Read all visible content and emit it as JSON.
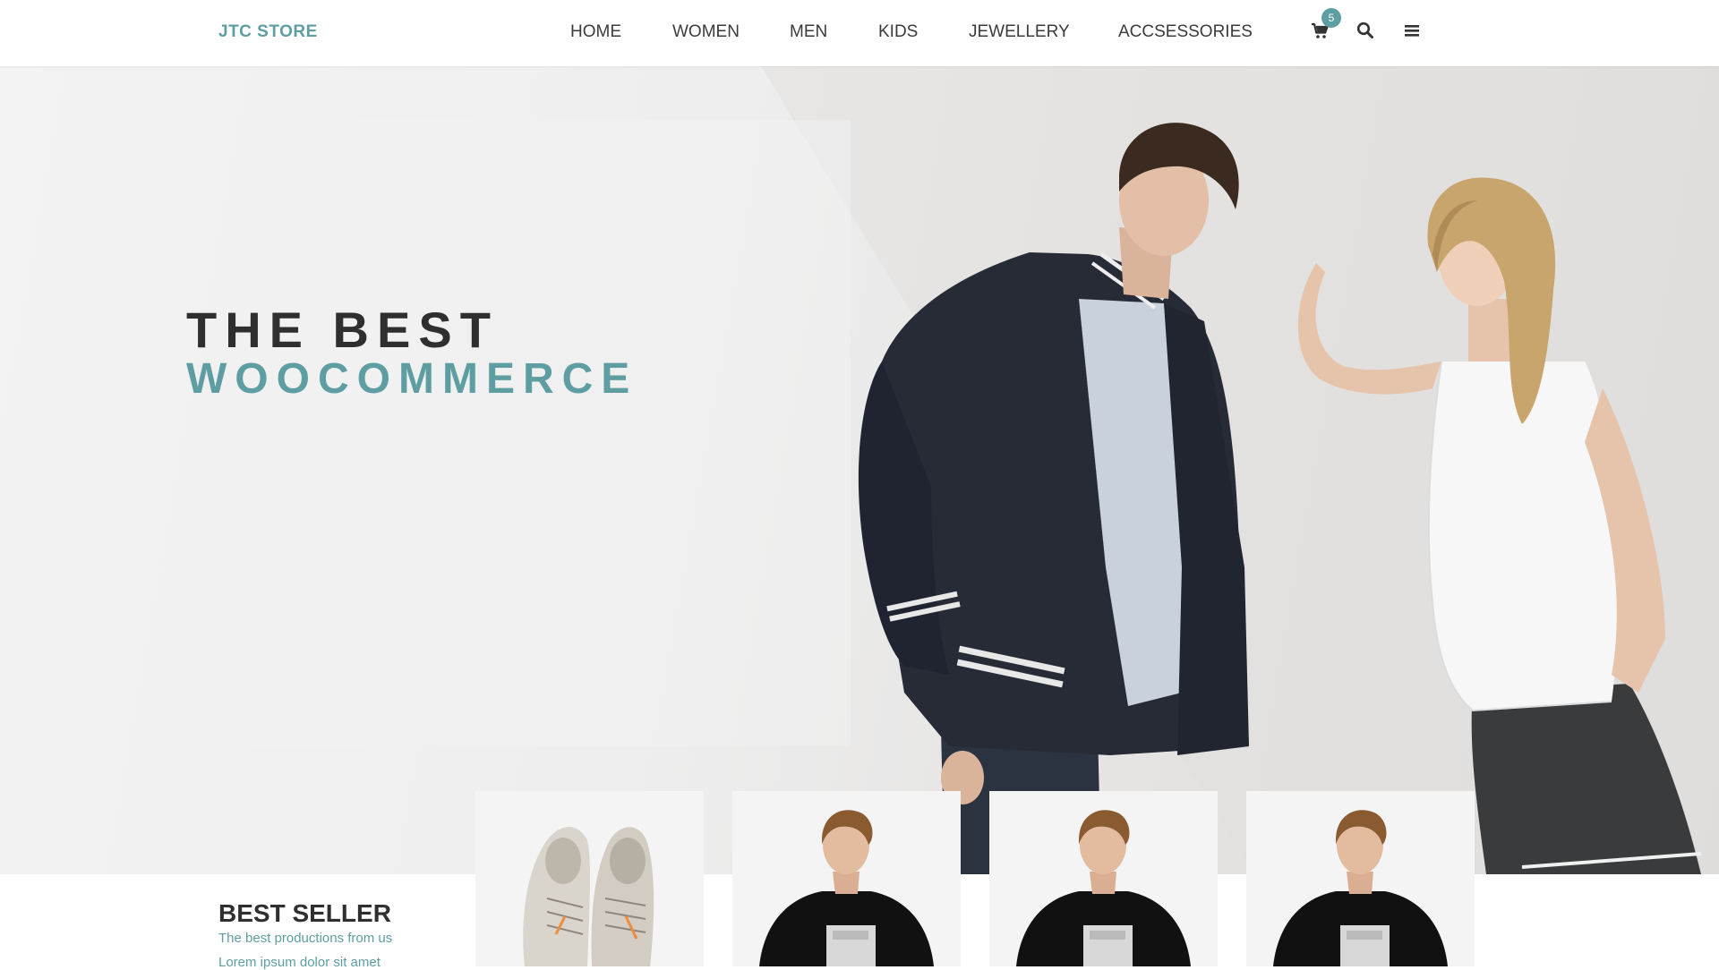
{
  "header": {
    "logo": "JTC STORE",
    "nav": [
      {
        "label": "HOME"
      },
      {
        "label": "WOMEN"
      },
      {
        "label": "MEN"
      },
      {
        "label": "KIDS"
      },
      {
        "label": "JEWELLERY"
      },
      {
        "label": "ACCSESSORIES"
      }
    ],
    "cart_count": "5",
    "icons": [
      "cart-icon",
      "search-icon",
      "menu-icon"
    ]
  },
  "hero": {
    "title_line1": "THE BEST",
    "title_line2": "WOOCOMMERCE"
  },
  "bestseller": {
    "heading": "BEST SELLER",
    "subheading": "The best productions from us",
    "description": "Lorem ipsum dolor sit amet"
  },
  "products": [
    {
      "image": "shoes"
    },
    {
      "image": "man-black-tshirt"
    },
    {
      "image": "man-black-tshirt"
    },
    {
      "image": "man-black-tshirt"
    }
  ],
  "colors": {
    "accent": "#5e9ea2",
    "text_dark": "#2f2f2f",
    "nav_text": "#3b3b3b"
  }
}
